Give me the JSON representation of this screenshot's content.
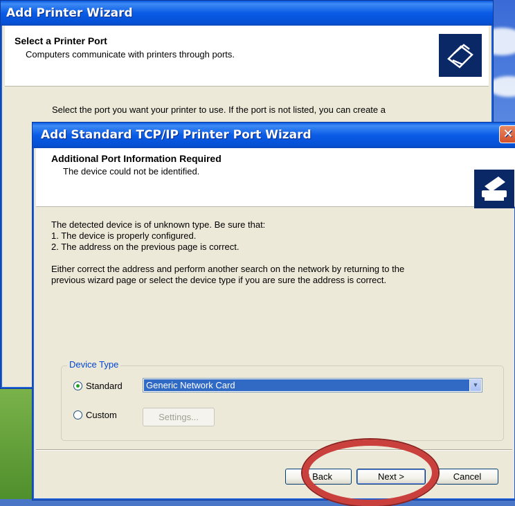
{
  "back_window": {
    "title": "Add Printer Wizard",
    "header_title": "Select a Printer Port",
    "header_subtitle": "Computers communicate with printers through ports.",
    "body_text": "Select the port you want your printer to use.  If the port is not listed, you can create a"
  },
  "front_window": {
    "title": "Add Standard TCP/IP Printer Port Wizard",
    "close_label": "✕",
    "header_title": "Additional Port Information Required",
    "header_subtitle": "The device could not be identified.",
    "para1_line1": "The detected device is of unknown type.  Be sure that:",
    "para1_line2": "1. The device is properly configured.",
    "para1_line3": "2.  The address on the previous page is correct.",
    "para2_line1": "Either correct the address and perform another search on the network by returning to the",
    "para2_line2": "previous wizard page or select the device type if you are sure the address is correct.",
    "device_type": {
      "legend": "Device Type",
      "standard_label": "Standard",
      "standard_selected": true,
      "custom_label": "Custom",
      "combo_value": "Generic Network Card",
      "settings_label": "Settings..."
    },
    "buttons": {
      "back_label": "< Back",
      "next_label": "Next >",
      "cancel_label": "Cancel"
    }
  },
  "annotation": {
    "color": "#c9403c"
  }
}
